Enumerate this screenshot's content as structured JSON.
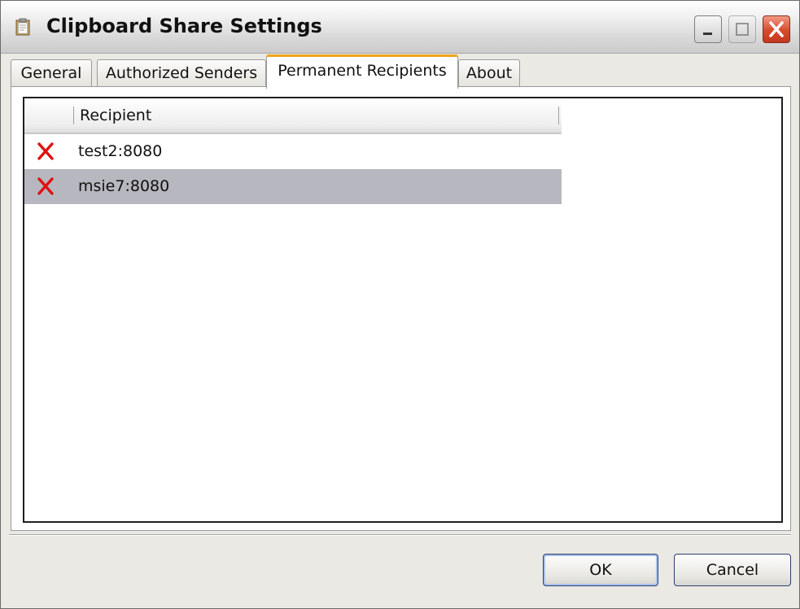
{
  "window": {
    "title": "Clipboard Share Settings",
    "icons": {
      "app": "clipboard-icon",
      "minimize": "minimize-icon",
      "maximize": "maximize-icon",
      "close": "close-icon"
    }
  },
  "tabs": [
    {
      "label": "General",
      "active": false
    },
    {
      "label": "Authorized Senders",
      "active": false
    },
    {
      "label": "Permanent Recipients",
      "active": true
    },
    {
      "label": "About",
      "active": false
    }
  ],
  "recipients_list": {
    "column_header": "Recipient",
    "rows": [
      {
        "value": "test2:8080",
        "selected": false,
        "action_icon": "delete-x-icon"
      },
      {
        "value": "msie7:8080",
        "selected": true,
        "action_icon": "delete-x-icon"
      }
    ]
  },
  "buttons": {
    "ok_label": "OK",
    "cancel_label": "Cancel"
  },
  "colors": {
    "active_tab_accent": "#f0a41e",
    "selected_row": "#b6b7bf",
    "delete_icon": "#e01010",
    "close_button": "#d84a2e"
  }
}
